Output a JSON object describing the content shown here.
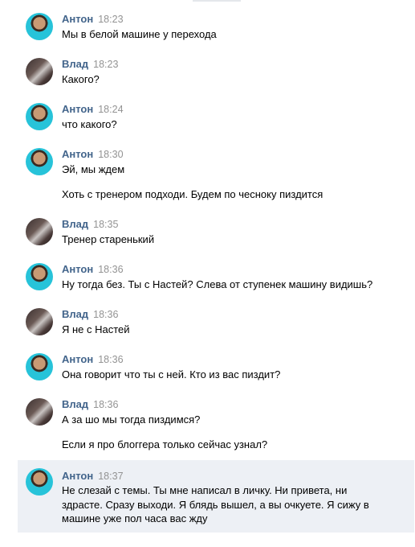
{
  "messages": [
    {
      "author": "Антон",
      "time": "18:23",
      "avatar": "anton-avatar",
      "lines": [
        "Мы в белой машине у перехода"
      ]
    },
    {
      "author": "Влад",
      "time": "18:23",
      "avatar": "vlad-avatar",
      "lines": [
        "Какого?"
      ]
    },
    {
      "author": "Антон",
      "time": "18:24",
      "avatar": "anton-avatar",
      "lines": [
        "что какого?"
      ]
    },
    {
      "author": "Антон",
      "time": "18:30",
      "avatar": "anton-avatar",
      "lines": [
        "Эй, мы ждем",
        "Хоть с тренером подходи. Будем по чесноку пиздится"
      ]
    },
    {
      "author": "Влад",
      "time": "18:35",
      "avatar": "vlad-avatar",
      "lines": [
        "Тренер старенький"
      ]
    },
    {
      "author": "Антон",
      "time": "18:36",
      "avatar": "anton-avatar",
      "lines": [
        "Ну тогда без. Ты с Настей? Слева от ступенек машину видишь?"
      ]
    },
    {
      "author": "Влад",
      "time": "18:36",
      "avatar": "vlad-avatar",
      "lines": [
        "Я не с Настей"
      ]
    },
    {
      "author": "Антон",
      "time": "18:36",
      "avatar": "anton-avatar",
      "lines": [
        "Она говорит что ты с ней. Кто из вас пиздит?"
      ]
    },
    {
      "author": "Влад",
      "time": "18:36",
      "avatar": "vlad-avatar",
      "lines": [
        "А за шо мы тогда пиздимся?",
        "Если я про блоггера только сейчас узнал?"
      ]
    },
    {
      "author": "Антон",
      "time": "18:37",
      "avatar": "anton-avatar",
      "lines": [
        "Не слезай с темы. Ты мне написал в личку. Ни привета, ни здрасте. Сразу выходи. Я блядь вышел, а вы очкуете. Я сижу в машине уже пол часа вас жду"
      ]
    }
  ],
  "colors": {
    "author": "#42648b",
    "time": "#939393",
    "highlight": "#edf0f5"
  }
}
